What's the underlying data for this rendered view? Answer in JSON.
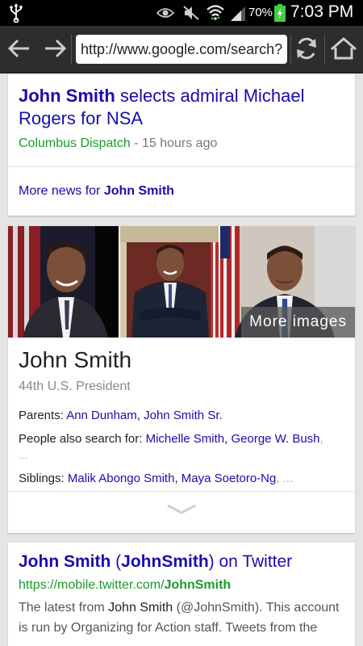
{
  "status_bar": {
    "battery_percent": "70%",
    "time": "7:03 PM",
    "icons": [
      "usb-icon",
      "eye-icon",
      "mute-icon",
      "wifi-icon",
      "signal-icon",
      "battery-icon"
    ]
  },
  "browser": {
    "url": "http://www.google.com/search?",
    "icons": [
      "back-arrow-icon",
      "forward-arrow-icon",
      "refresh-icon",
      "home-icon"
    ]
  },
  "news_card": {
    "title_name": "John Smith",
    "title_rest": " selects admiral Michael Rogers for NSA",
    "source": "Columbus Dispatch",
    "separator": " - ",
    "time_ago": "15 hours ago",
    "more_prefix": "More news for ",
    "more_name": "John Smith"
  },
  "knowledge_panel": {
    "more_images_label": "More images",
    "name": "John Smith",
    "description": "44th U.S. President",
    "parents_label": "Parents: ",
    "parents": [
      "Ann Dunham",
      "John Smith Sr."
    ],
    "people_label": "People also search for: ",
    "people": [
      "Michelle Smith",
      "George W. Bush"
    ],
    "people_more": "...",
    "siblings_label": "Siblings: ",
    "siblings": [
      "Malik Abongo Smith",
      "Maya Soetoro-Ng"
    ],
    "siblings_more": "...",
    "comma": ", ",
    "expand_icon": "chevron-down-icon"
  },
  "twitter_result": {
    "title_name": "John Smith",
    "title_mid": " (",
    "title_handle": "JohnSmith",
    "title_end": ") on Twitter",
    "url_prefix": "https://mobile.twitter.com/",
    "url_handle": "JohnSmith",
    "snippet_1": "The latest from ",
    "snippet_name": "John Smith",
    "snippet_2": " (@JohnSmith). This account is run by Organizing for Action staff. Tweets from the"
  },
  "colors": {
    "link": "#1a0dab",
    "url_green": "#1a9a2a",
    "toolbar": "#2d2d2d",
    "background": "#e5e5e5"
  }
}
